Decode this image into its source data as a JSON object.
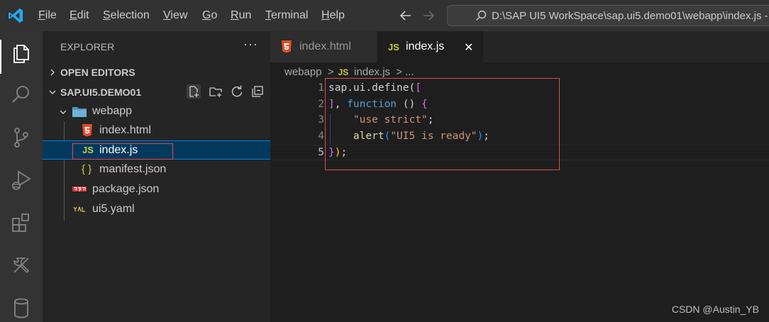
{
  "menu": [
    "File",
    "Edit",
    "Selection",
    "View",
    "Go",
    "Run",
    "Terminal",
    "Help"
  ],
  "menu_underline": [
    "F",
    "E",
    "S",
    "V",
    "G",
    "R",
    "T",
    "H"
  ],
  "search": {
    "text": "D:\\SAP UI5 WorkSpace\\sap.ui5.demo01\\webapp\\index.js - s"
  },
  "sidebar": {
    "title": "EXPLORER",
    "more_actions": "···",
    "open_editors": "OPEN EDITORS",
    "project": "SAP.UI5.DEMO01",
    "tree": [
      {
        "label": "webapp",
        "icon": "folder-icon"
      },
      {
        "label": "index.html",
        "icon": "html5-icon"
      },
      {
        "label": "index.js",
        "icon": "js-icon",
        "icon_text": "JS"
      },
      {
        "label": "manifest.json",
        "icon": "json-icon",
        "icon_text": "{ }"
      },
      {
        "label": "package.json",
        "icon": "npm-icon"
      },
      {
        "label": "ui5.yaml",
        "icon": "yaml-icon"
      }
    ]
  },
  "tabs": [
    {
      "label": "index.html",
      "icon": "html5-icon"
    },
    {
      "label": "index.js",
      "icon": "js-icon",
      "icon_text": "JS",
      "close": "✕"
    }
  ],
  "breadcrumb": {
    "folder": "webapp",
    "sep": ">",
    "icon_text": "JS",
    "file": "index.js",
    "more": "..."
  },
  "code": {
    "line_numbers": [
      "1",
      "2",
      "3",
      "4",
      "5"
    ],
    "lines": [
      [
        [
          "sap.ui.define(",
          "t-default"
        ],
        [
          "[",
          "t-brack1"
        ]
      ],
      [
        [
          "]",
          "t-brack1"
        ],
        [
          ", ",
          "t-default"
        ],
        [
          "function",
          "t-keyword"
        ],
        [
          " () ",
          "t-default"
        ],
        [
          "{",
          "t-brack1"
        ]
      ],
      [
        [
          "    ",
          "t-default"
        ],
        [
          "\"use strict\"",
          "t-string"
        ],
        [
          ";",
          "t-default"
        ]
      ],
      [
        [
          "    ",
          "t-default"
        ],
        [
          "alert",
          "t-func"
        ],
        [
          "(",
          "t-brack2"
        ],
        [
          "\"UI5 is ready\"",
          "t-string"
        ],
        [
          ")",
          "t-brack2"
        ],
        [
          ";",
          "t-default"
        ]
      ],
      [
        [
          "}",
          "t-brack1"
        ],
        [
          ")",
          "t-brace"
        ],
        [
          ";",
          "t-default"
        ]
      ]
    ]
  },
  "watermark": "CSDN @Austin_YB",
  "colors": {
    "accent": "#007fd4",
    "highlight": "#e0484e",
    "js": "#cbcb41",
    "html": "#e44d26"
  }
}
